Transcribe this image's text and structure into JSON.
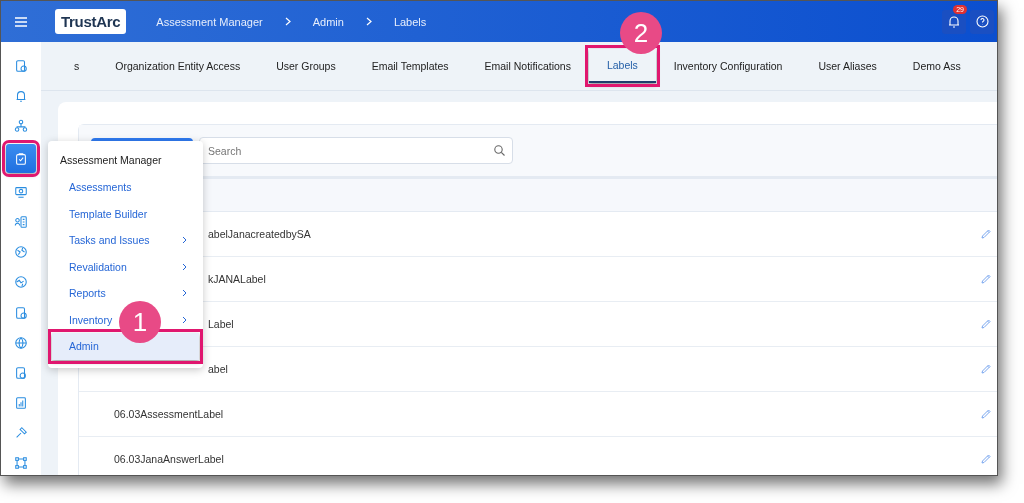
{
  "top_bar": {
    "logo": "TrustArc",
    "breadcrumb": [
      "Assessment Manager",
      "Admin",
      "Labels"
    ],
    "notification_count": "29"
  },
  "sidebar": {
    "items": [
      {
        "selected": false,
        "highlighted": false
      },
      {
        "selected": false,
        "highlighted": false
      },
      {
        "selected": false,
        "highlighted": false
      },
      {
        "selected": true,
        "highlighted": true
      },
      {
        "selected": false,
        "highlighted": false
      },
      {
        "selected": false,
        "highlighted": false
      },
      {
        "selected": false,
        "highlighted": false
      },
      {
        "selected": false,
        "highlighted": false
      },
      {
        "selected": false,
        "highlighted": false
      },
      {
        "selected": false,
        "highlighted": false
      },
      {
        "selected": false,
        "highlighted": false
      },
      {
        "selected": false,
        "highlighted": false
      },
      {
        "selected": false,
        "highlighted": false
      },
      {
        "selected": false,
        "highlighted": false
      }
    ]
  },
  "tabs": [
    {
      "label": "s",
      "selected": false,
      "highlighted": false
    },
    {
      "label": "Organization Entity Access",
      "selected": false,
      "highlighted": false
    },
    {
      "label": "User Groups",
      "selected": false,
      "highlighted": false
    },
    {
      "label": "Email Templates",
      "selected": false,
      "highlighted": false
    },
    {
      "label": "Email Notifications",
      "selected": false,
      "highlighted": false
    },
    {
      "label": "Labels",
      "selected": true,
      "highlighted": true
    },
    {
      "label": "Inventory Configuration",
      "selected": false,
      "highlighted": false
    },
    {
      "label": "User Aliases",
      "selected": false,
      "highlighted": false
    },
    {
      "label": "Demo Ass",
      "selected": false,
      "highlighted": false
    }
  ],
  "search": {
    "placeholder": "Search"
  },
  "table": {
    "rows": [
      {
        "label": "abelJanacreatedbySA",
        "covered": true
      },
      {
        "label": "kJANALabel",
        "covered": true
      },
      {
        "label": "Label",
        "covered": true
      },
      {
        "label": "abel",
        "covered": true
      },
      {
        "label": "06.03AssessmentLabel"
      },
      {
        "label": "06.03JanaAnswerLabel"
      }
    ]
  },
  "menu": {
    "title": "Assessment Manager",
    "items": [
      {
        "label": "Assessments",
        "submenu": false,
        "selected": false,
        "highlighted": false
      },
      {
        "label": "Template Builder",
        "submenu": false,
        "selected": false,
        "highlighted": false
      },
      {
        "label": "Tasks and Issues",
        "submenu": true,
        "selected": false,
        "highlighted": false
      },
      {
        "label": "Revalidation",
        "submenu": true,
        "selected": false,
        "highlighted": false
      },
      {
        "label": "Reports",
        "submenu": true,
        "selected": false,
        "highlighted": false
      },
      {
        "label": "Inventory",
        "submenu": true,
        "selected": false,
        "highlighted": false
      },
      {
        "label": "Admin",
        "submenu": false,
        "selected": true,
        "highlighted": true
      }
    ]
  },
  "callouts": [
    {
      "number": "2"
    },
    {
      "number": "1"
    }
  ]
}
